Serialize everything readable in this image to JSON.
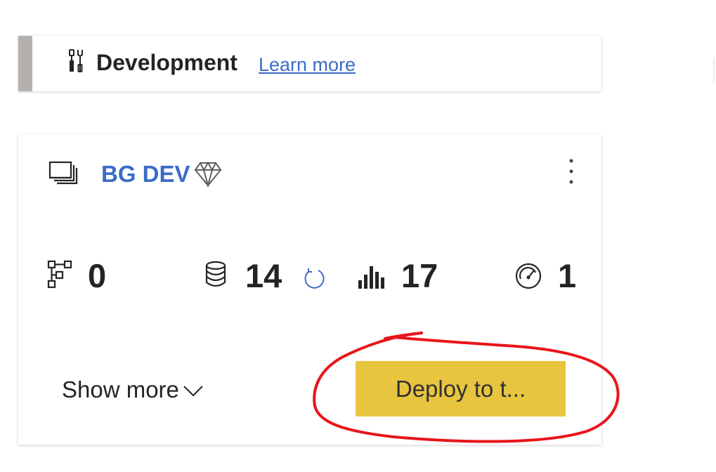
{
  "stage": {
    "title": "Development",
    "learn_more": "Learn more",
    "accent_color": "#b3b0ad",
    "icon": "tools-icon"
  },
  "workspace": {
    "name": "BG DEV",
    "icon": "workspace-icon",
    "premium_icon": "diamond-icon",
    "more_options_icon": "more-vertical-icon",
    "link_color": "#3a6cc6"
  },
  "counts": {
    "dataflows": {
      "icon": "dataflow-icon",
      "value": "0"
    },
    "datasets": {
      "icon": "database-icon",
      "value": "14",
      "refresh_icon": "refresh-icon"
    },
    "reports": {
      "icon": "bar-chart-icon",
      "value": "17"
    },
    "dashboards": {
      "icon": "gauge-icon",
      "value": "1"
    }
  },
  "footer": {
    "show_more": "Show more",
    "show_more_icon": "chevron-down-icon",
    "deploy_label": "Deploy to t...",
    "deploy_color": "#e8c53f"
  },
  "annotation": {
    "color": "#e8141a",
    "shape": "hand-drawn-circle"
  }
}
